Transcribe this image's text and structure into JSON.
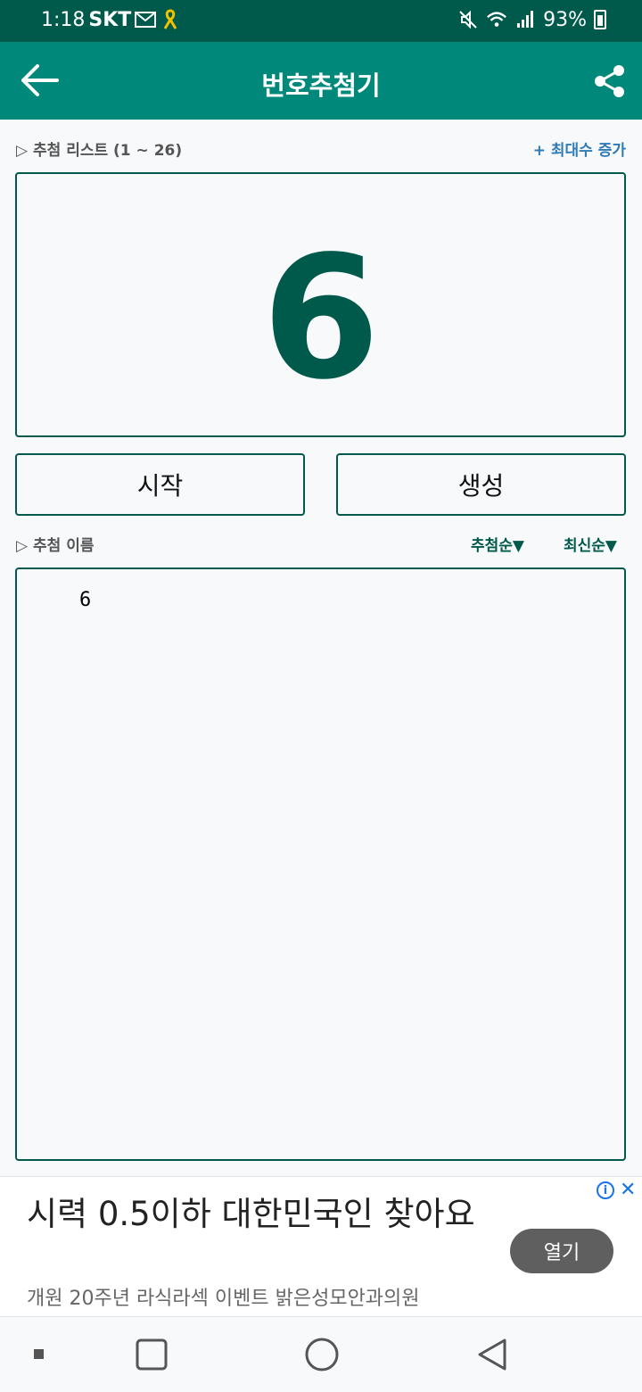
{
  "status_bar": {
    "time": "1:18",
    "carrier": "SKT",
    "battery": "93%",
    "icons": [
      "mail-icon",
      "ribbon-icon",
      "mute-icon",
      "wifi-icon",
      "signal-icon",
      "battery-icon"
    ]
  },
  "app_bar": {
    "title": "번호추첨기",
    "back_icon": "arrow-left-icon",
    "share_icon": "share-icon"
  },
  "draw_section": {
    "label": "▷ 추첨 리스트 (1 ~ 26)",
    "increase_link": "+ 최대수 증가",
    "result": "6"
  },
  "buttons": {
    "start": "시작",
    "generate": "생성"
  },
  "names_section": {
    "label": "▷ 추첨 이름",
    "sort_draw": "추첨순▼",
    "sort_recent": "최신순▼",
    "items": [
      "6"
    ]
  },
  "ad": {
    "title": "시력 0.5이하 대한민국인 찾아요",
    "subtitle": "개원 20주년 라식라섹 이벤트 밝은성모안과의원",
    "button": "열기",
    "info_icon": "info-icon",
    "close_icon": "close-icon"
  },
  "colors": {
    "status_bar": "#005a4c",
    "app_bar": "#00897b",
    "accent": "#005a4c",
    "link": "#2f7bb6"
  }
}
